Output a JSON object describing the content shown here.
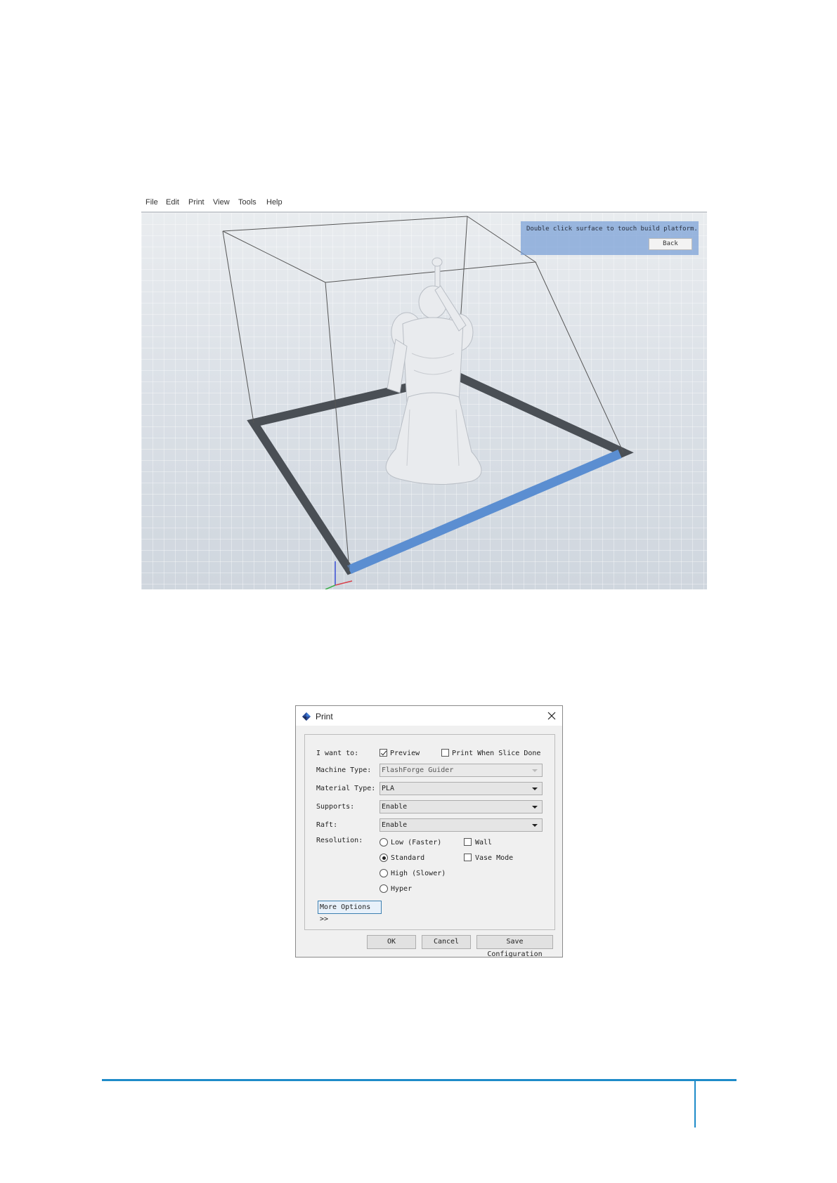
{
  "menubar": {
    "items": [
      "File",
      "Edit",
      "Print",
      "View",
      "Tools",
      "Help"
    ]
  },
  "viewport": {
    "hint_text": "Double click surface to touch build platform.",
    "back_label": "Back"
  },
  "print_dialog": {
    "title": "Print",
    "i_want_to_label": "I want to:",
    "preview_label": "Preview",
    "preview_checked": true,
    "print_when_slice_done_label": "Print When Slice Done",
    "print_when_slice_done_checked": false,
    "machine_type_label": "Machine Type:",
    "machine_type_value": "FlashForge Guider",
    "material_type_label": "Material Type:",
    "material_type_value": "PLA",
    "supports_label": "Supports:",
    "supports_value": "Enable",
    "raft_label": "Raft:",
    "raft_value": "Enable",
    "resolution_label": "Resolution:",
    "resolution_options": [
      "Low (Faster)",
      "Standard",
      "High (Slower)",
      "Hyper"
    ],
    "resolution_selected": "Standard",
    "wall_label": "Wall",
    "wall_checked": false,
    "vase_mode_label": "Vase Mode",
    "vase_mode_checked": false,
    "more_options_label": "More Options >>",
    "ok_label": "OK",
    "cancel_label": "Cancel",
    "save_configuration_label": "Save Configuration"
  },
  "colors": {
    "accent": "#1e8bc9",
    "platform_border": "#4a4f55",
    "platform_highlight": "#5b8ed1"
  }
}
